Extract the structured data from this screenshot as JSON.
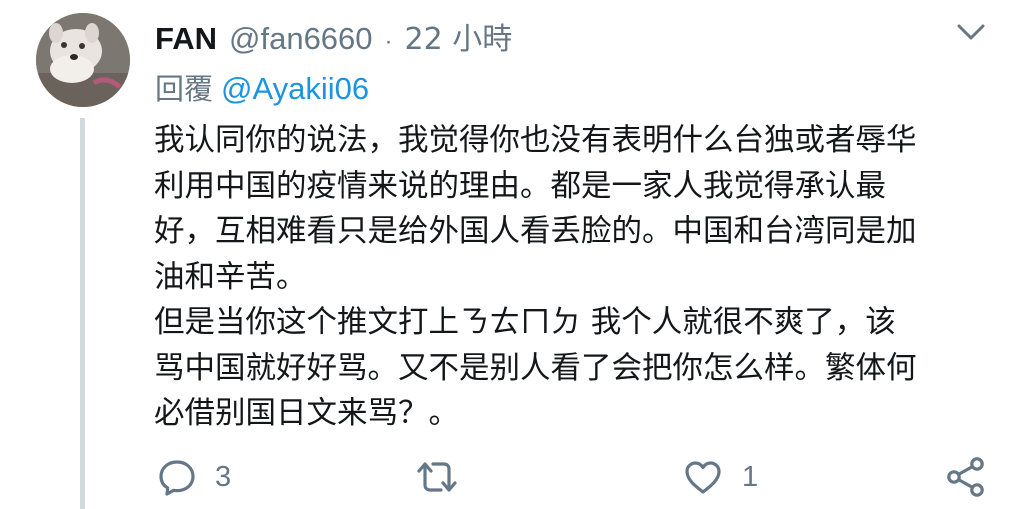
{
  "tweet": {
    "author_name": "FAN",
    "author_handle": "@fan6660",
    "separator": "·",
    "time": "22 小時",
    "reply_prefix": "回覆",
    "reply_to": "@Ayakii06",
    "body_lines": [
      "我认同你的说法，我觉得你也没有表明什么台独或者辱华",
      "利用中国的疫情来说的理由。都是一家人我觉得承认最",
      "好，互相难看只是给外国人看丢脸的。中国和台湾同是加",
      "油和辛苦。",
      "但是当你这个推文打上ㄋㄊㄇㄉ 我个人就很不爽了，该",
      "骂中国就好好骂。又不是别人看了会把你怎么样。繁体何",
      "必借别国日文来骂？。"
    ],
    "reply_count": "3",
    "retweet_count": "",
    "like_count": "1"
  },
  "icons": {
    "avatar": "dog-photo-avatar",
    "caret": "chevron-down-icon",
    "reply": "comment-bubble-icon",
    "retweet": "retweet-arrows-icon",
    "like": "heart-outline-icon",
    "share": "share-nodes-icon"
  },
  "colors": {
    "text_primary": "#14171a",
    "text_secondary": "#657786",
    "link": "#1b95e0",
    "thread_line": "#cfd9de",
    "background": "#ffffff"
  }
}
